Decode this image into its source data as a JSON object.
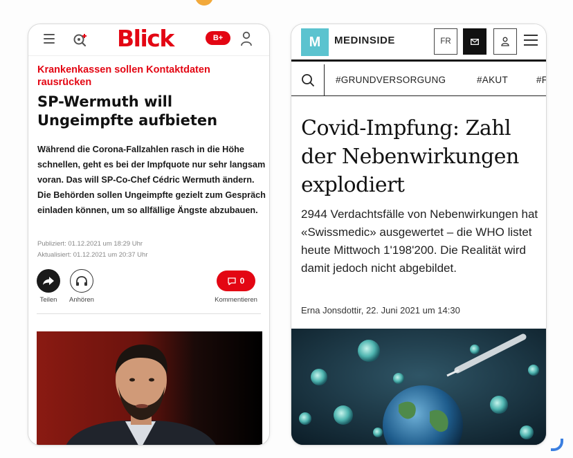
{
  "blick": {
    "logo": "Blick",
    "plus_badge": "B+",
    "kicker": "Krankenkassen sollen Kontaktdaten rausrücken",
    "title": "SP-Wermuth will Ungeimpfte aufbieten",
    "lead": "Während die Corona-Fallzahlen rasch in die Höhe schnellen, geht es bei der Impfquote nur sehr langsam voran. Das will SP-Co-Chef Cédric Wermuth ändern. Die Behörden sollen Ungeimpfte gezielt zum Gespräch einladen können, um so allfällige Ängste abzubauen.",
    "published": "Publiziert: 01.12.2021 um 18:29 Uhr",
    "updated": "Aktualisiert: 01.12.2021 um 20:37 Uhr",
    "actions": {
      "share_label": "Teilen",
      "listen_label": "Anhören",
      "comment_count": "0",
      "comment_label": "Kommentieren"
    },
    "icons": {
      "menu": "hamburger-icon",
      "live": "live-search-icon",
      "user": "user-icon",
      "share": "share-arrow-icon",
      "listen": "headphones-icon",
      "comment": "comment-icon"
    },
    "brand_color": "#e30613"
  },
  "medinside": {
    "logo_letter": "M",
    "brand": "MEDINSIDE",
    "lang_button": "FR",
    "tags": [
      "#GRUNDVERSORGUNG",
      "#AKUT",
      "#F"
    ],
    "title": "Covid-Impfung: Zahl der Nebenwirkungen explodiert",
    "lead": "2944 Verdachtsfälle von Nebenwirkungen hat «Swissmedic» ausgewertet – die WHO listet heute Mittwoch 1'198'200. Die Realität wird damit jedoch nicht abgebildet.",
    "byline": "Erna Jonsdottir, 22. Juni 2021 um 14:30",
    "icons": {
      "search": "search-icon",
      "mail": "mail-icon",
      "account": "user-icon",
      "menu": "hamburger-icon"
    },
    "brand_color": "#5bc3cf"
  }
}
